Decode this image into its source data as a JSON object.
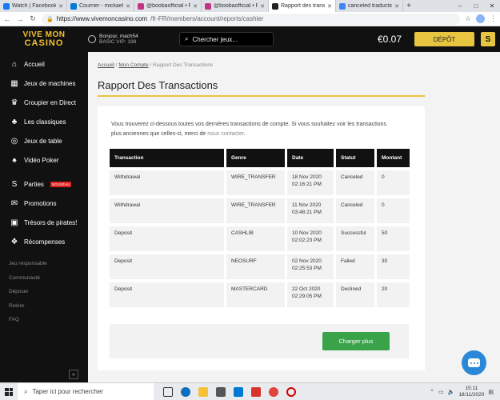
{
  "browser": {
    "tabs": [
      {
        "label": "Watch | Facebook",
        "color": "#1877f2",
        "active": false
      },
      {
        "label": "Courrier - mickael0",
        "color": "#0078d4",
        "active": false
      },
      {
        "label": "@boobaofficial • Ph",
        "color": "#c13584",
        "active": false
      },
      {
        "label": "@boobaofficial • Ph",
        "color": "#c13584",
        "active": false
      },
      {
        "label": "Rapport des transac",
        "color": "#222222",
        "active": true
      },
      {
        "label": "canceled traduction",
        "color": "#4285f4",
        "active": false
      }
    ],
    "new_tab": "+",
    "url_host": "https://www.vivemoncasino.com",
    "url_path": "/fr-FR/members/account/reports/cashier"
  },
  "header": {
    "logo_line1": "VIVE MON",
    "logo_line2": "CASINO",
    "greeting": "Bonjour, mach54",
    "vip": "BASIC VIP: 198",
    "search_placeholder": "Chercher jeux...",
    "balance": "€0.07",
    "deposit_label": "DÉPÔT",
    "brand_icon_letter": "S"
  },
  "sidebar": {
    "items": [
      {
        "label": "Accueil",
        "icon": "home-icon",
        "glyph": "⌂"
      },
      {
        "label": "Jeux de machines",
        "icon": "slot-machine-icon",
        "glyph": "▦"
      },
      {
        "label": "Croupier en Direct",
        "icon": "dealer-icon",
        "glyph": "♛"
      },
      {
        "label": "Les classiques",
        "icon": "cards-icon",
        "glyph": "♣"
      },
      {
        "label": "Jeux de table",
        "icon": "roulette-icon",
        "glyph": "◎"
      },
      {
        "label": "Vidéo Poker",
        "icon": "poker-icon",
        "glyph": "♠"
      }
    ],
    "items2": [
      {
        "label": "Parties",
        "icon": "parties-icon",
        "glyph": "S",
        "badge": "NOUVEAU"
      },
      {
        "label": "Promotions",
        "icon": "megaphone-icon",
        "glyph": "✉"
      },
      {
        "label": "Trésors de pirates!",
        "icon": "treasure-icon",
        "glyph": "▣"
      },
      {
        "label": "Récompenses",
        "icon": "gift-icon",
        "glyph": "❖"
      }
    ],
    "links": [
      "Jeu responsable",
      "Communauté",
      "Déposer",
      "Retirer",
      "FAQ"
    ],
    "collapse": "«"
  },
  "main": {
    "breadcrumb": {
      "home": "Accueil",
      "sep1": " / ",
      "account": "Mon Compte",
      "sep2": " / ",
      "current": "Rapport Des Transactions"
    },
    "title": "Rapport Des Transactions",
    "intro_line1": "Vous trouverez ci-dessous toutes vos dernières transactions de compte. Si vous souhaitez voir les transactions",
    "intro_line2_a": "plus anciennes que celles-ci, merci de",
    "intro_contact": "nous contacter",
    "intro_end": ".",
    "table": {
      "headers": [
        "Transaction",
        "Genre",
        "Date",
        "Statut",
        "Montant"
      ],
      "rows": [
        [
          "Withdrawal",
          "WIRE_TRANSFER",
          "18 Nov 2020",
          "02:16:21 PM",
          "Canceled",
          "0"
        ],
        [
          "Withdrawal",
          "WIRE_TRANSFER",
          "11 Nov 2020",
          "03:48:21 PM",
          "Canceled",
          "0"
        ],
        [
          "Deposit",
          "CASHLIB",
          "10 Nov 2020",
          "02:02:23 PM",
          "Successful",
          "50"
        ],
        [
          "Deposit",
          "NEOSURF",
          "02 Nov 2020",
          "02:25:53 PM",
          "Failed",
          "30"
        ],
        [
          "Deposit",
          "MASTERCARD",
          "22 Oct 2020",
          "02:29:05 PM",
          "Declined",
          "20"
        ]
      ]
    },
    "load_more": "Charger plus"
  },
  "taskbar": {
    "search_placeholder": "Taper ici pour rechercher",
    "time": "15:11",
    "date": "18/11/2020"
  }
}
